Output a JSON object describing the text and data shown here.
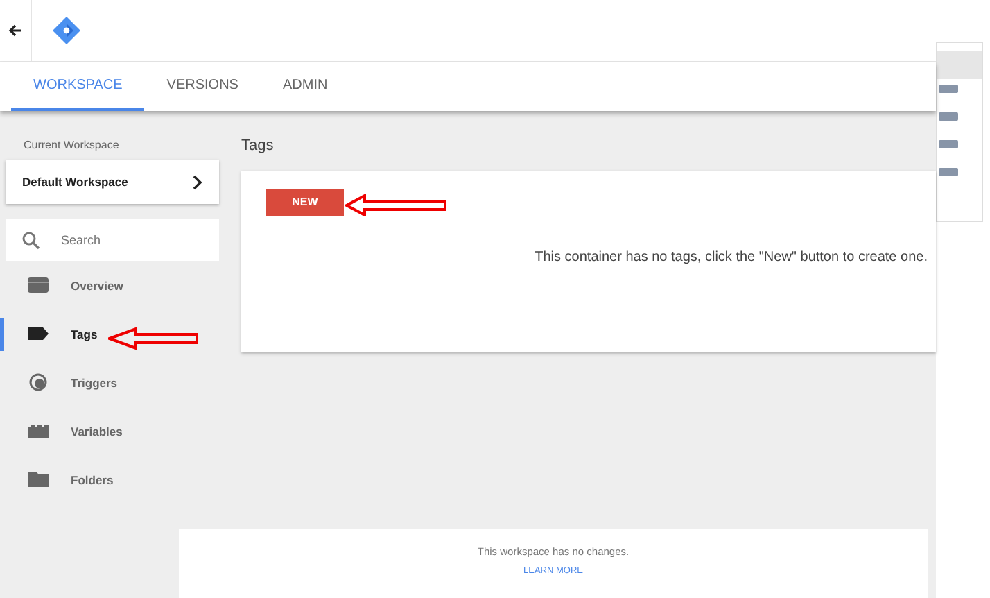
{
  "tabs": [
    {
      "label": "WORKSPACE",
      "selected": true
    },
    {
      "label": "VERSIONS",
      "selected": false
    },
    {
      "label": "ADMIN",
      "selected": false
    }
  ],
  "sidebar": {
    "workspace_label": "Current Workspace",
    "workspace_name": "Default Workspace",
    "search": {
      "placeholder": "Search"
    },
    "items": [
      {
        "label": "Overview",
        "kind": "overview",
        "selected": false
      },
      {
        "label": "Tags",
        "kind": "tags",
        "selected": true
      },
      {
        "label": "Triggers",
        "kind": "triggers",
        "selected": false
      },
      {
        "label": "Variables",
        "kind": "variables",
        "selected": false
      },
      {
        "label": "Folders",
        "kind": "folders",
        "selected": false
      }
    ]
  },
  "main": {
    "title": "Tags",
    "new_button": "NEW",
    "empty_message": "This container has no tags, click the \"New\" button to create one."
  },
  "changes": {
    "message": "This workspace has no changes.",
    "link": "LEARN MORE"
  }
}
